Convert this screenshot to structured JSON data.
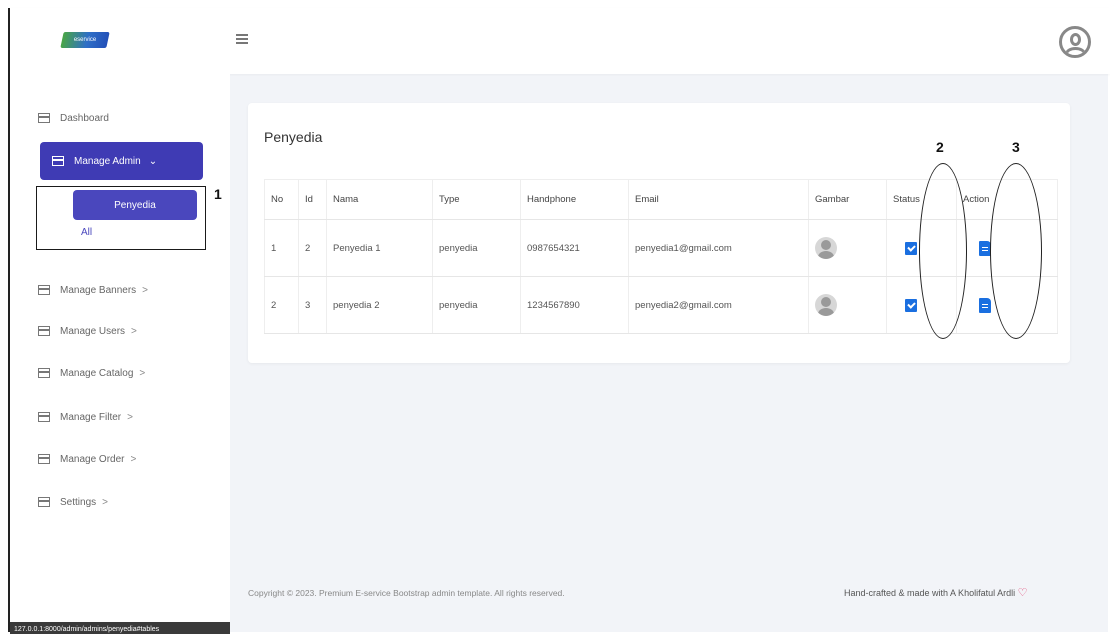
{
  "brand": {
    "logo_text": "eservice"
  },
  "sidebar": {
    "dashboard": "Dashboard",
    "manage_admin": "Manage Admin",
    "penyedia": "Penyedia",
    "all": "All",
    "items": [
      {
        "label": "Manage Banners",
        "chev": ">"
      },
      {
        "label": "Manage Users",
        "chev": ">"
      },
      {
        "label": "Manage Catalog",
        "chev": ">"
      },
      {
        "label": "Manage Filter",
        "chev": ">"
      },
      {
        "label": "Manage Order",
        "chev": ">"
      },
      {
        "label": "Settings",
        "chev": ">"
      }
    ],
    "admin_chev": "⌄"
  },
  "annotations": {
    "one": "1",
    "two": "2",
    "three": "3"
  },
  "card": {
    "title": "Penyedia",
    "columns": [
      "No",
      "Id",
      "Nama",
      "Type",
      "Handphone",
      "Email",
      "Gambar",
      "Status",
      "Action"
    ],
    "rows": [
      {
        "no": "1",
        "id": "2",
        "nama": "Penyedia 1",
        "type": "penyedia",
        "handphone": "0987654321",
        "email": "penyedia1@gmail.com"
      },
      {
        "no": "2",
        "id": "3",
        "nama": "penyedia 2",
        "type": "penyedia",
        "handphone": "1234567890",
        "email": "penyedia2@gmail.com"
      }
    ]
  },
  "footer": {
    "copyright": "Copyright © 2023. Premium E-service Bootstrap admin template. All rights reserved.",
    "credit": "Hand-crafted & made with A Kholifatul Ardli",
    "heart": "♡"
  },
  "statusbar": {
    "url": "127.0.0.1:8000/admin/admins/penyedia#tables"
  }
}
